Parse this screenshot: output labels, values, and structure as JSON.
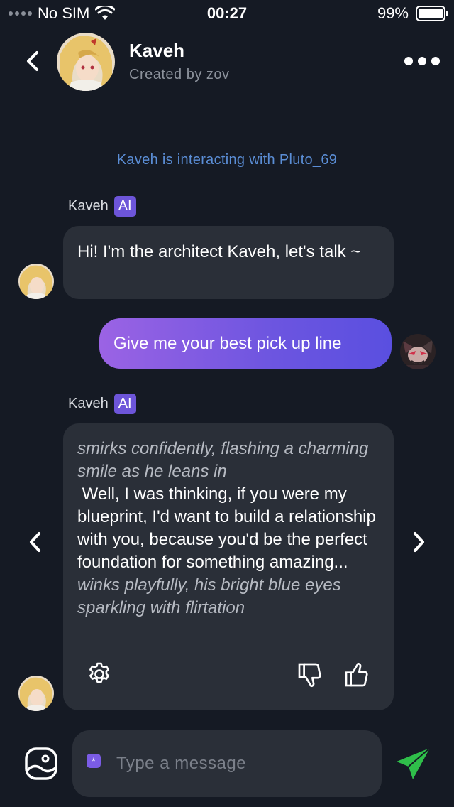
{
  "status_bar": {
    "carrier": "No SIM",
    "time": "00:27",
    "battery": "99%",
    "battery_level": 0.99
  },
  "header": {
    "name": "Kaveh",
    "subtitle": "Created by zov",
    "avatar_icon": "kaveh-avatar"
  },
  "system_note": "Kaveh is interacting with Pluto_69",
  "messages": [
    {
      "sender": "Kaveh",
      "badge": "AI",
      "text": "Hi! I'm the architect Kaveh, let's talk ~"
    },
    {
      "sender": "user",
      "text": "Give me your best pick up line"
    },
    {
      "sender": "Kaveh",
      "badge": "AI",
      "action1": "smirks confidently, flashing a charming smile as he leans in",
      "speech": " Well, I was thinking, if you were my blueprint, I'd want to build a relationship with you, because you'd be the perfect foundation for something amazing...",
      "action2": "winks playfully, his bright blue eyes sparkling with flirtation"
    }
  ],
  "composer": {
    "placeholder": "Type a message",
    "sparkle_glyph": "*"
  },
  "colors": {
    "background": "#151a24",
    "bubble": "#2a2f38",
    "accent": "#6d55d9",
    "send": "#2fbf4a",
    "link": "#5b8ed6"
  }
}
